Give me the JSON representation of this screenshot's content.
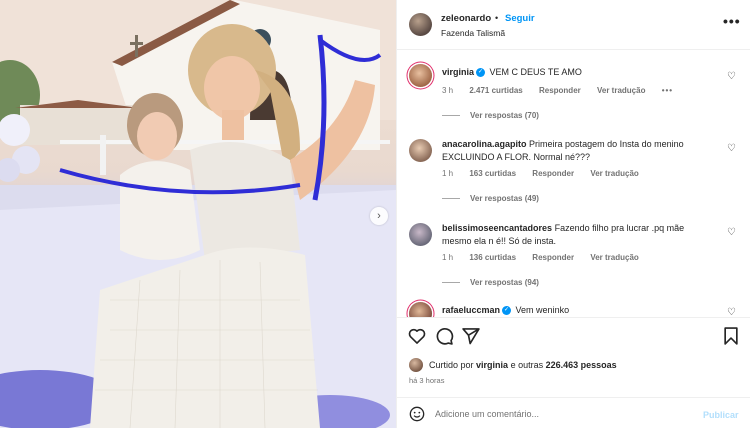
{
  "post": {
    "author": "zeleonardo",
    "separator": "•",
    "follow_label": "Seguir",
    "location": "Fazenda Talismã",
    "more_icon": "more-horizontal-icon",
    "carousel_next_icon": "chevron-right-icon"
  },
  "comments": [
    {
      "user": "virginia",
      "verified": true,
      "text": "VEM C DEUS TE AMO",
      "time": "3 h",
      "likes": "2.471 curtidas",
      "reply_label": "Responder",
      "translate_label": "Ver tradução",
      "more": "•••",
      "replies_label": "Ver respostas (70)"
    },
    {
      "user": "anacarolina.agapito",
      "verified": false,
      "text": "Primeira postagem do Insta do menino EXCLUINDO A FLOR. Normal né???",
      "time": "1 h",
      "likes": "163 curtidas",
      "reply_label": "Responder",
      "translate_label": "Ver tradução",
      "replies_label": "Ver respostas (49)"
    },
    {
      "user": "belissimoseencantadores",
      "verified": false,
      "text": "Fazendo filho pra lucrar .pq mãe mesmo ela n é!! Só de insta.",
      "time": "1 h",
      "likes": "136 curtidas",
      "reply_label": "Responder",
      "translate_label": "Ver tradução",
      "replies_label": "Ver respostas (94)"
    },
    {
      "user": "rafaeluccman",
      "verified": true,
      "text": "Vem weninko"
    }
  ],
  "actions": {
    "like_icon": "heart-icon",
    "comment_icon": "comment-icon",
    "share_icon": "send-icon",
    "save_icon": "bookmark-icon"
  },
  "likes_summary": {
    "prefix": "Curtido por",
    "user": "virginia",
    "middle": "e outras",
    "count": "226.463 pessoas"
  },
  "posted_ago": "há 3 horas",
  "add_comment": {
    "placeholder": "Adicione um comentário...",
    "publish_label": "Publicar",
    "emoji_icon": "emoji-icon"
  },
  "colors": {
    "accent": "#0095f6",
    "publish_disabled": "#b2dffc",
    "muted": "#737373"
  }
}
